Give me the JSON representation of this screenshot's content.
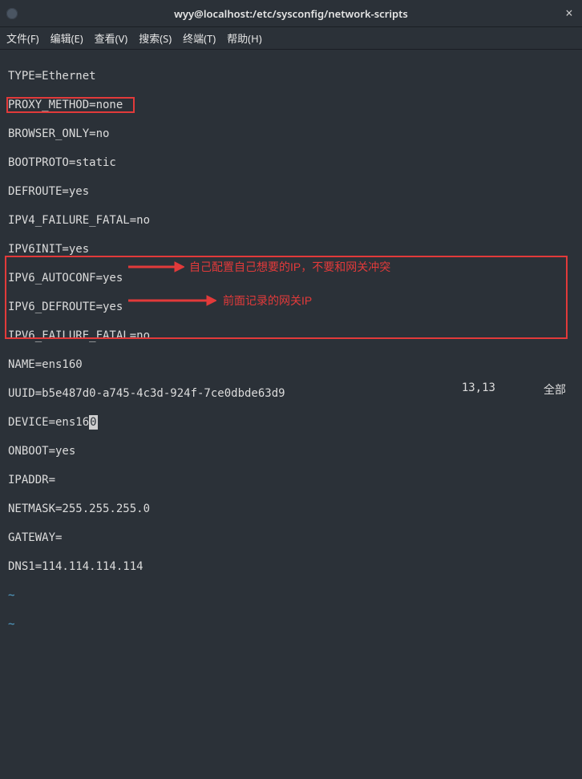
{
  "window": {
    "title": "wyy@localhost:/etc/sysconfig/network-scripts"
  },
  "menu": {
    "file": "文件(F)",
    "edit": "编辑(E)",
    "view": "查看(V)",
    "search": "搜索(S)",
    "terminal": "终端(T)",
    "help": "帮助(H)"
  },
  "content": {
    "l1": "TYPE=Ethernet",
    "l2": "PROXY_METHOD=none",
    "l3": "BROWSER_ONLY=no",
    "l4": "BOOTPROTO=static",
    "l5": "DEFROUTE=yes",
    "l6": "IPV4_FAILURE_FATAL=no",
    "l7": "IPV6INIT=yes",
    "l8": "IPV6_AUTOCONF=yes",
    "l9": "IPV6_DEFROUTE=yes",
    "l10": "IPV6_FAILURE_FATAL=no",
    "l11": "NAME=ens160",
    "l12": "UUID=b5e487d0-a745-4c3d-924f-7ce0dbde63d9",
    "l13a": "DEVICE=ens16",
    "l13b": "0",
    "l14": "ONBOOT=yes",
    "l15": "IPADDR=",
    "l16": "NETMASK=255.255.255.0",
    "l17": "GATEWAY=",
    "l18": "DNS1=114.114.114.114",
    "tilde": "~"
  },
  "annotations": {
    "a1": "自己配置自己想要的IP，不要和网关冲突",
    "a2": "前面记录的网关IP"
  },
  "status": {
    "pos": "13,13",
    "mode": "全部"
  }
}
